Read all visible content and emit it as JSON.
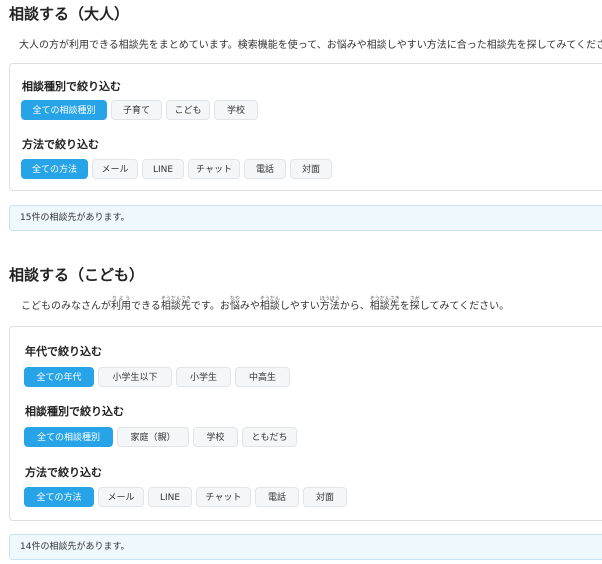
{
  "adult": {
    "title": "相談する（大人）",
    "description": "大人の方が利用できる相談先をまとめています。検索機能を使って、お悩みや相談しやすい方法に合った相談先を探してみてください。",
    "filter_type": {
      "label": "相談種別で絞り込む",
      "options": [
        "全ての相談種別",
        "子育て",
        "こども",
        "学校"
      ]
    },
    "filter_method": {
      "label": "方法で絞り込む",
      "options": [
        "全ての方法",
        "メール",
        "LINE",
        "チャット",
        "電話",
        "対面"
      ]
    },
    "result": "15件の相談先があります。"
  },
  "child": {
    "title": "相談する（こども）",
    "description": {
      "p1": "こどものみなさんが",
      "riyou": "利用",
      "riyou_rt": "りよう",
      "p2": "できる",
      "soudansaki1": "相談先",
      "soudansaki1_rt": "そうだんさき",
      "p3": "です。お",
      "naya": "悩",
      "naya_rt": "なや",
      "p4": "みや",
      "soudan": "相談",
      "soudan_rt": "そうだん",
      "p5": "しやすい",
      "houhou": "方法",
      "houhou_rt": "ほうほう",
      "p6": "から、",
      "soudansaki2": "相談先",
      "soudansaki2_rt": "そうだんさき",
      "p7": "を",
      "saga": "探",
      "saga_rt": "さが",
      "p8": "してみてください。"
    },
    "filter_age": {
      "label": "年代で絞り込む",
      "options": [
        "全ての年代",
        "小学生以下",
        "小学生",
        "中高生"
      ]
    },
    "filter_type": {
      "label": "相談種別で絞り込む",
      "options": [
        "全ての相談種別",
        "家庭（親）",
        "学校",
        "ともだち"
      ]
    },
    "filter_method": {
      "label": "方法で絞り込む",
      "options": [
        "全ての方法",
        "メール",
        "LINE",
        "チャット",
        "電話",
        "対面"
      ]
    },
    "result": "14件の相談先があります。"
  }
}
